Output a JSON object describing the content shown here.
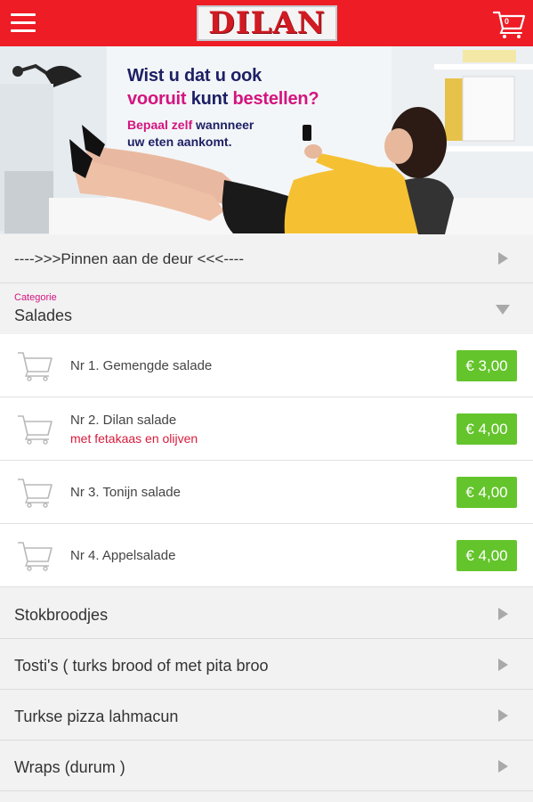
{
  "header": {
    "logo_text": "DILAN",
    "cart_count": "0",
    "accent_color": "#ee1c25"
  },
  "banner": {
    "line1": "Wist u dat u ook",
    "line2_part1": "vooruit",
    "line2_part2": "kunt",
    "line2_part3": "bestellen?",
    "line3_part1": "Bepaal zelf",
    "line3_part2": "wannneer",
    "line4": "uw eten aankomt."
  },
  "promo": {
    "label": "---->>>Pinnen aan de deur <<<----"
  },
  "category": {
    "caption": "Categorie",
    "name": "Salades"
  },
  "items": [
    {
      "name": "Nr 1. Gemengde salade",
      "subtitle": "",
      "price": "€ 3,00"
    },
    {
      "name": "Nr 2. Dilan salade",
      "subtitle": "met fetakaas en olijven",
      "price": "€ 4,00"
    },
    {
      "name": "Nr 3. Tonijn salade",
      "subtitle": "",
      "price": "€ 4,00"
    },
    {
      "name": "Nr 4. Appelsalade",
      "subtitle": "",
      "price": "€ 4,00"
    }
  ],
  "other_categories": [
    {
      "label": "Stokbroodjes"
    },
    {
      "label": "Tosti's ( turks brood of met pita broo"
    },
    {
      "label": "Turkse pizza lahmacun"
    },
    {
      "label": "Wraps (durum )"
    }
  ],
  "colors": {
    "price_green": "#64c42b",
    "highlight_pink": "#d4147f",
    "navy": "#1d1f64"
  }
}
